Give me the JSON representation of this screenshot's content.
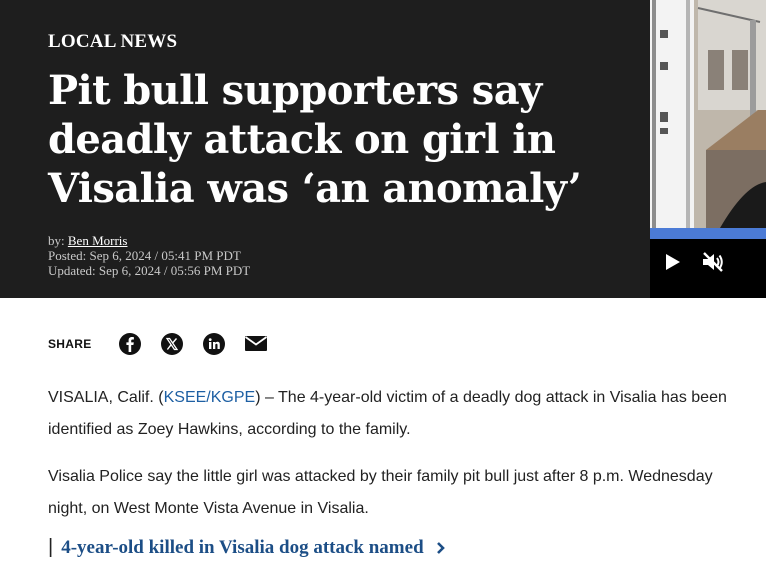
{
  "article": {
    "kicker": "LOCAL NEWS",
    "headline": "Pit bull supporters say deadly attack on girl in Visalia was ‘an anomaly’",
    "byline_prefix": "by: ",
    "author": "Ben Morris",
    "posted": "Posted: Sep 6, 2024 / 05:41 PM PDT",
    "updated": "Updated: Sep 6, 2024 / 05:56 PM PDT"
  },
  "video": {
    "play_icon": "play-icon",
    "mute_icon": "muted-speaker-icon",
    "accent_color": "#4b7bd6"
  },
  "share": {
    "label": "SHARE",
    "icons": [
      "facebook-icon",
      "x-icon",
      "linkedin-icon",
      "email-icon"
    ]
  },
  "body": {
    "p1_prefix": "VISALIA, Calif. (",
    "p1_link": "KSEE/KGPE",
    "p1_suffix": ") – The 4-year-old victim of a deadly dog attack in Visalia has been identified as Zoey Hawkins, according to the family.",
    "p2": "Visalia Police say the little girl was attacked by their family pit bull just after 8 p.m. Wednesday night, on West Monte Vista Avenue in Visalia."
  },
  "related": {
    "bar": "|",
    "title": "4-year-old killed in Visalia dog attack named"
  },
  "colors": {
    "hero_bg": "#1e1e1e",
    "link": "#1d5fa3",
    "related_link": "#1c4e86"
  }
}
